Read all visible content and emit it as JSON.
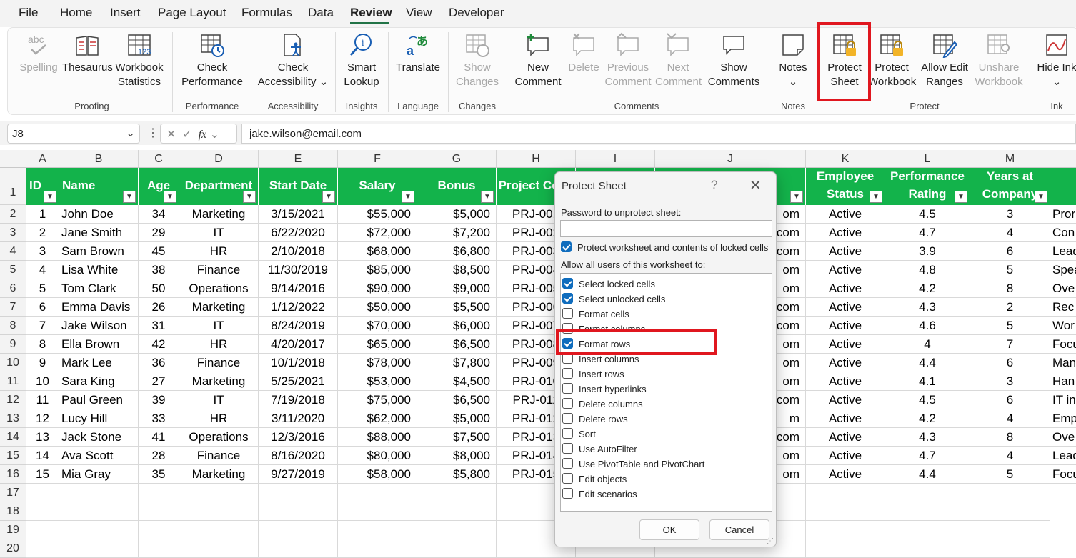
{
  "menu": {
    "tabs": [
      "File",
      "Home",
      "Insert",
      "Page Layout",
      "Formulas",
      "Data",
      "Review",
      "View",
      "Developer"
    ],
    "active": "Review"
  },
  "ribbon": {
    "spelling": "Spelling",
    "thesaurus": "Thesaurus",
    "wb_stats": "Workbook Statistics",
    "check_perf": "Check Performance",
    "check_access": "Check Accessibility",
    "smart_lookup": "Smart Lookup",
    "translate": "Translate",
    "show_changes": "Show Changes",
    "new_comment": "New Comment",
    "delete": "Delete",
    "prev_comment": "Previous Comment",
    "next_comment": "Next Comment",
    "show_comments": "Show Comments",
    "notes": "Notes",
    "protect_sheet": "Protect Sheet",
    "protect_workbook": "Protect Workbook",
    "allow_edit": "Allow Edit Ranges",
    "unshare": "Unshare Workbook",
    "hide_ink": "Hide Ink",
    "groups": {
      "proofing": "Proofing",
      "performance": "Performance",
      "accessibility": "Accessibility",
      "insights": "Insights",
      "language": "Language",
      "changes": "Changes",
      "comments": "Comments",
      "notes": "Notes",
      "protect": "Protect",
      "ink": "Ink"
    }
  },
  "formula_bar": {
    "cell_ref": "J8",
    "fx": "fx",
    "value": "jake.wilson@email.com"
  },
  "columns": [
    "A",
    "B",
    "C",
    "D",
    "E",
    "F",
    "G",
    "H",
    "I",
    "J",
    "K",
    "L",
    "M"
  ],
  "row_numbers": [
    "1",
    "2",
    "3",
    "4",
    "5",
    "6",
    "7",
    "8",
    "9",
    "10",
    "11",
    "12",
    "13",
    "14",
    "15",
    "16",
    "17",
    "18",
    "19",
    "20"
  ],
  "headers": {
    "id": "ID",
    "name": "Name",
    "age": "Age",
    "dept": "Department",
    "start": "Start Date",
    "salary": "Salary",
    "bonus": "Bonus",
    "proj": "Project Code",
    "status": "Employee Status",
    "perf": "Performance Rating",
    "years": "Years at Company"
  },
  "rows": [
    [
      "1",
      "John Doe",
      "34",
      "Marketing",
      "3/15/2021",
      "$55,000",
      "$5,000",
      "PRJ-001",
      "om",
      "Active",
      "4.5",
      "3",
      "Pror"
    ],
    [
      "2",
      "Jane Smith",
      "29",
      "IT",
      "6/22/2020",
      "$72,000",
      "$7,200",
      "PRJ-002",
      "com",
      "Active",
      "4.7",
      "4",
      "Con"
    ],
    [
      "3",
      "Sam Brown",
      "45",
      "HR",
      "2/10/2018",
      "$68,000",
      "$6,800",
      "PRJ-003",
      "com",
      "Active",
      "3.9",
      "6",
      "Lead"
    ],
    [
      "4",
      "Lisa White",
      "38",
      "Finance",
      "11/30/2019",
      "$85,000",
      "$8,500",
      "PRJ-004",
      "om",
      "Active",
      "4.8",
      "5",
      "Spea"
    ],
    [
      "5",
      "Tom Clark",
      "50",
      "Operations",
      "9/14/2016",
      "$90,000",
      "$9,000",
      "PRJ-005",
      "om",
      "Active",
      "4.2",
      "8",
      "Ove"
    ],
    [
      "6",
      "Emma Davis",
      "26",
      "Marketing",
      "1/12/2022",
      "$50,000",
      "$5,500",
      "PRJ-006",
      "l.com",
      "Active",
      "4.3",
      "2",
      "Rec"
    ],
    [
      "7",
      "Jake Wilson",
      "31",
      "IT",
      "8/24/2019",
      "$70,000",
      "$6,000",
      "PRJ-007",
      "com",
      "Active",
      "4.6",
      "5",
      "Wor"
    ],
    [
      "8",
      "Ella Brown",
      "42",
      "HR",
      "4/20/2017",
      "$65,000",
      "$6,500",
      "PRJ-008",
      "om",
      "Active",
      "4",
      "7",
      "Focu"
    ],
    [
      "9",
      "Mark Lee",
      "36",
      "Finance",
      "10/1/2018",
      "$78,000",
      "$7,800",
      "PRJ-009",
      "om",
      "Active",
      "4.4",
      "6",
      "Man"
    ],
    [
      "10",
      "Sara King",
      "27",
      "Marketing",
      "5/25/2021",
      "$53,000",
      "$4,500",
      "PRJ-010",
      "om",
      "Active",
      "4.1",
      "3",
      "Han"
    ],
    [
      "11",
      "Paul Green",
      "39",
      "IT",
      "7/19/2018",
      "$75,000",
      "$6,500",
      "PRJ-011",
      "com",
      "Active",
      "4.5",
      "6",
      "IT in"
    ],
    [
      "12",
      "Lucy Hill",
      "33",
      "HR",
      "3/11/2020",
      "$62,000",
      "$5,000",
      "PRJ-012",
      "m",
      "Active",
      "4.2",
      "4",
      "Emp"
    ],
    [
      "13",
      "Jack Stone",
      "41",
      "Operations",
      "12/3/2016",
      "$88,000",
      "$7,500",
      "PRJ-013",
      "com",
      "Active",
      "4.3",
      "8",
      "Ove"
    ],
    [
      "14",
      "Ava Scott",
      "28",
      "Finance",
      "8/16/2020",
      "$80,000",
      "$8,000",
      "PRJ-014",
      "om",
      "Active",
      "4.7",
      "4",
      "Lead"
    ],
    [
      "15",
      "Mia Gray",
      "35",
      "Marketing",
      "9/27/2019",
      "$58,000",
      "$5,800",
      "PRJ-015",
      "om",
      "Active",
      "4.4",
      "5",
      "Focu"
    ]
  ],
  "dialog": {
    "title": "Protect Sheet",
    "help": "?",
    "close": "✕",
    "password_label": "Password to unprotect sheet:",
    "protect_label": "Protect worksheet and contents of locked cells",
    "allow_label": "Allow all users of this worksheet to:",
    "options": [
      {
        "label": "Select locked cells",
        "checked": true
      },
      {
        "label": "Select unlocked cells",
        "checked": true
      },
      {
        "label": "Format cells",
        "checked": false
      },
      {
        "label": "Format columns",
        "checked": false
      },
      {
        "label": "Format rows",
        "checked": true
      },
      {
        "label": "Insert columns",
        "checked": false
      },
      {
        "label": "Insert rows",
        "checked": false
      },
      {
        "label": "Insert hyperlinks",
        "checked": false
      },
      {
        "label": "Delete columns",
        "checked": false
      },
      {
        "label": "Delete rows",
        "checked": false
      },
      {
        "label": "Sort",
        "checked": false
      },
      {
        "label": "Use AutoFilter",
        "checked": false
      },
      {
        "label": "Use PivotTable and PivotChart",
        "checked": false
      },
      {
        "label": "Edit objects",
        "checked": false
      },
      {
        "label": "Edit scenarios",
        "checked": false
      }
    ],
    "ok": "OK",
    "cancel": "Cancel"
  },
  "colors": {
    "header_green": "#13b34b",
    "highlight_red": "#e0171f",
    "accent_blue": "#0f6cbd",
    "excel_green": "#217346"
  }
}
